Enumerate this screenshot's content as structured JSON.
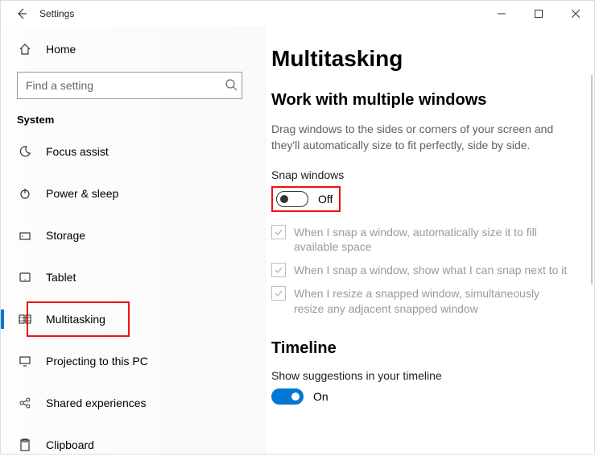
{
  "titlebar": {
    "title": "Settings"
  },
  "sidebar": {
    "home_label": "Home",
    "search_placeholder": "Find a setting",
    "group_header": "System",
    "items": [
      {
        "label": "Focus assist"
      },
      {
        "label": "Power & sleep"
      },
      {
        "label": "Storage"
      },
      {
        "label": "Tablet"
      },
      {
        "label": "Multitasking"
      },
      {
        "label": "Projecting to this PC"
      },
      {
        "label": "Shared experiences"
      },
      {
        "label": "Clipboard"
      }
    ]
  },
  "main": {
    "heading": "Multitasking",
    "section1_title": "Work with multiple windows",
    "section1_desc": "Drag windows to the sides or corners of your screen and they'll automatically size to fit perfectly, side by side.",
    "snap_label": "Snap windows",
    "snap_state": "Off",
    "checks": [
      "When I snap a window, automatically size it to fill available space",
      "When I snap a window, show what I can snap next to it",
      "When I resize a snapped window, simultaneously resize any adjacent snapped window"
    ],
    "section2_title": "Timeline",
    "timeline_label": "Show suggestions in your timeline",
    "timeline_state": "On"
  }
}
